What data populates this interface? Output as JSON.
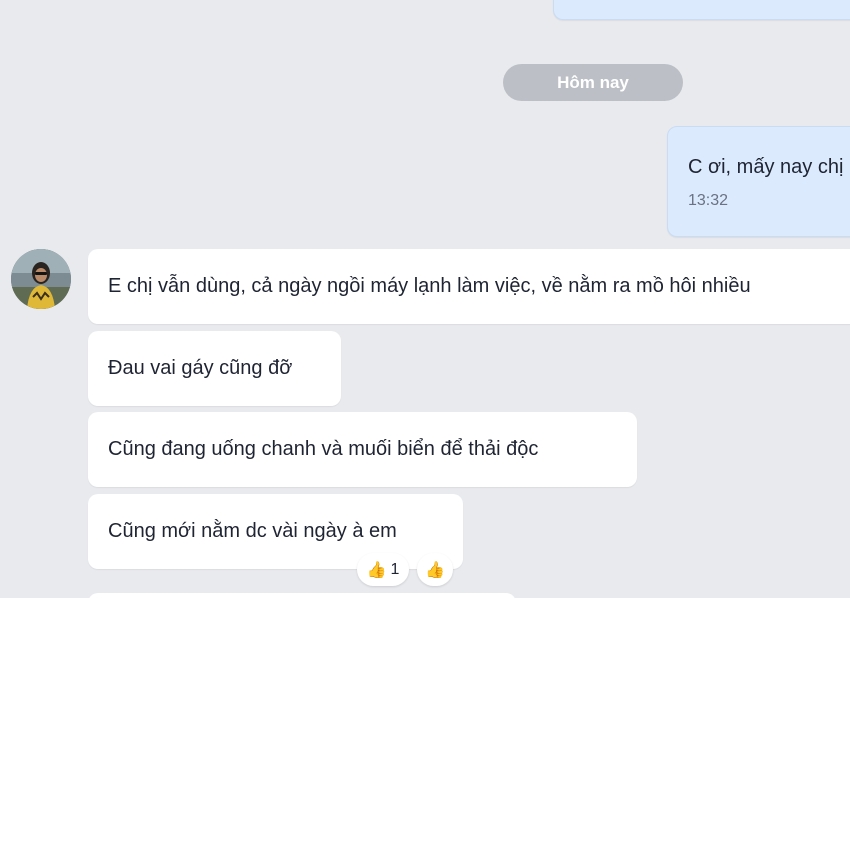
{
  "chat": {
    "date_separator": "Hôm nay",
    "outgoing": [
      {
        "text": "C ơi, mấy nay chị",
        "time": "13:32"
      }
    ],
    "incoming": [
      {
        "text": "E chị vẫn dùng, cả ngày ngồi máy lạnh làm việc, về nằm ra mồ hôi nhiều"
      },
      {
        "text": "Đau vai gáy cũng đỡ"
      },
      {
        "text": "Cũng đang uống chanh và muối biển để thải độc"
      },
      {
        "text": "Cũng mới nằm dc vài ngày à em"
      }
    ],
    "reactions": {
      "summary": {
        "icon": "thumbs-up-icon",
        "count": "1"
      },
      "add": {
        "icon": "thumbs-up-icon"
      }
    },
    "colors": {
      "background": "#e9eaee",
      "incoming_bubble": "#ffffff",
      "outgoing_bubble": "#dbeafd",
      "separator": "#bcbfc6"
    }
  }
}
